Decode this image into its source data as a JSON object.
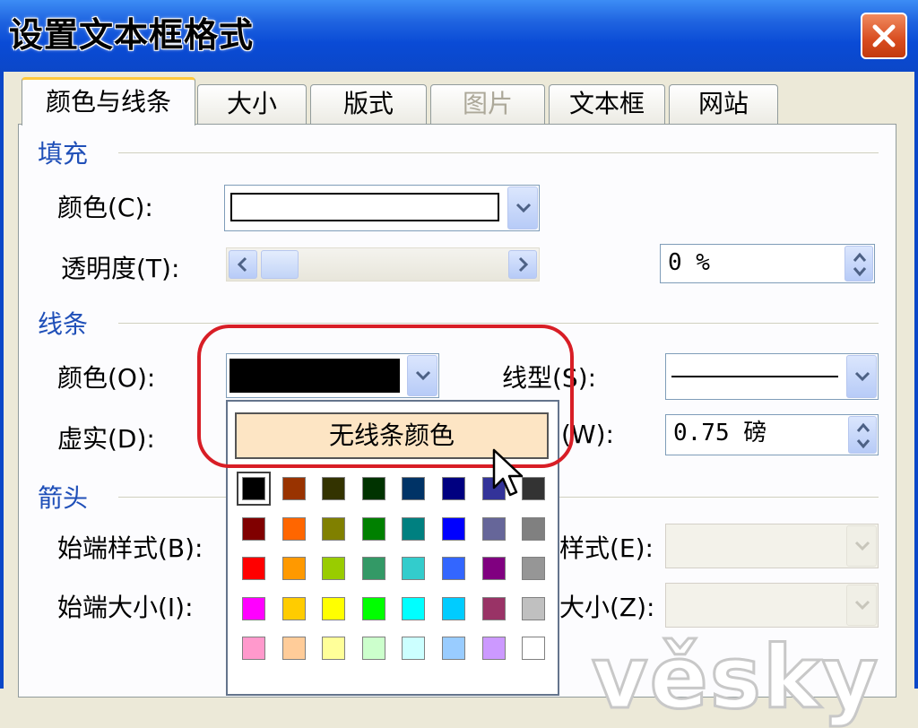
{
  "window": {
    "title": "设置文本框格式"
  },
  "tabs": [
    {
      "label": "颜色与线条",
      "active": true,
      "enabled": true
    },
    {
      "label": "大小",
      "active": false,
      "enabled": true
    },
    {
      "label": "版式",
      "active": false,
      "enabled": true
    },
    {
      "label": "图片",
      "active": false,
      "enabled": false
    },
    {
      "label": "文本框",
      "active": false,
      "enabled": true
    },
    {
      "label": "网站",
      "active": false,
      "enabled": true
    }
  ],
  "fill": {
    "group_label": "填充",
    "color_label": "颜色(C):",
    "transparency_label": "透明度(T):",
    "transparency_value": "0 %"
  },
  "line": {
    "group_label": "线条",
    "color_label": "颜色(O):",
    "line_style_label": "线型(S):",
    "dash_label": "虚实(D):",
    "weight_label_suffix": "(W):",
    "weight_value": "0.75 磅"
  },
  "arrows": {
    "group_label": "箭头",
    "begin_style_label": "始端样式(B):",
    "begin_size_label": "始端大小(I):",
    "end_style_label_suffix": "样式(E):",
    "end_size_label_suffix": "大小(Z):"
  },
  "color_popup": {
    "no_line_label": "无线条颜色",
    "swatches": [
      [
        "#000000",
        "#993300",
        "#333300",
        "#003300",
        "#003366",
        "#000080",
        "#333399",
        "#333333"
      ],
      [
        "#800000",
        "#ff6600",
        "#808000",
        "#008000",
        "#008080",
        "#0000ff",
        "#666699",
        "#808080"
      ],
      [
        "#ff0000",
        "#ff9900",
        "#99cc00",
        "#339966",
        "#33cccc",
        "#3366ff",
        "#800080",
        "#969696"
      ],
      [
        "#ff00ff",
        "#ffcc00",
        "#ffff00",
        "#00ff00",
        "#00ffff",
        "#00ccff",
        "#993366",
        "#c0c0c0"
      ],
      [
        "#ff99cc",
        "#ffcc99",
        "#ffff99",
        "#ccffcc",
        "#ccffff",
        "#99ccff",
        "#cc99ff",
        "#ffffff"
      ]
    ]
  },
  "watermark": "věsky",
  "colors": {
    "titlebar": "#0b47c8",
    "highlight": "#d81e26",
    "group_label": "#1f4fb8",
    "no_line_button_bg": "#fde5c4"
  }
}
